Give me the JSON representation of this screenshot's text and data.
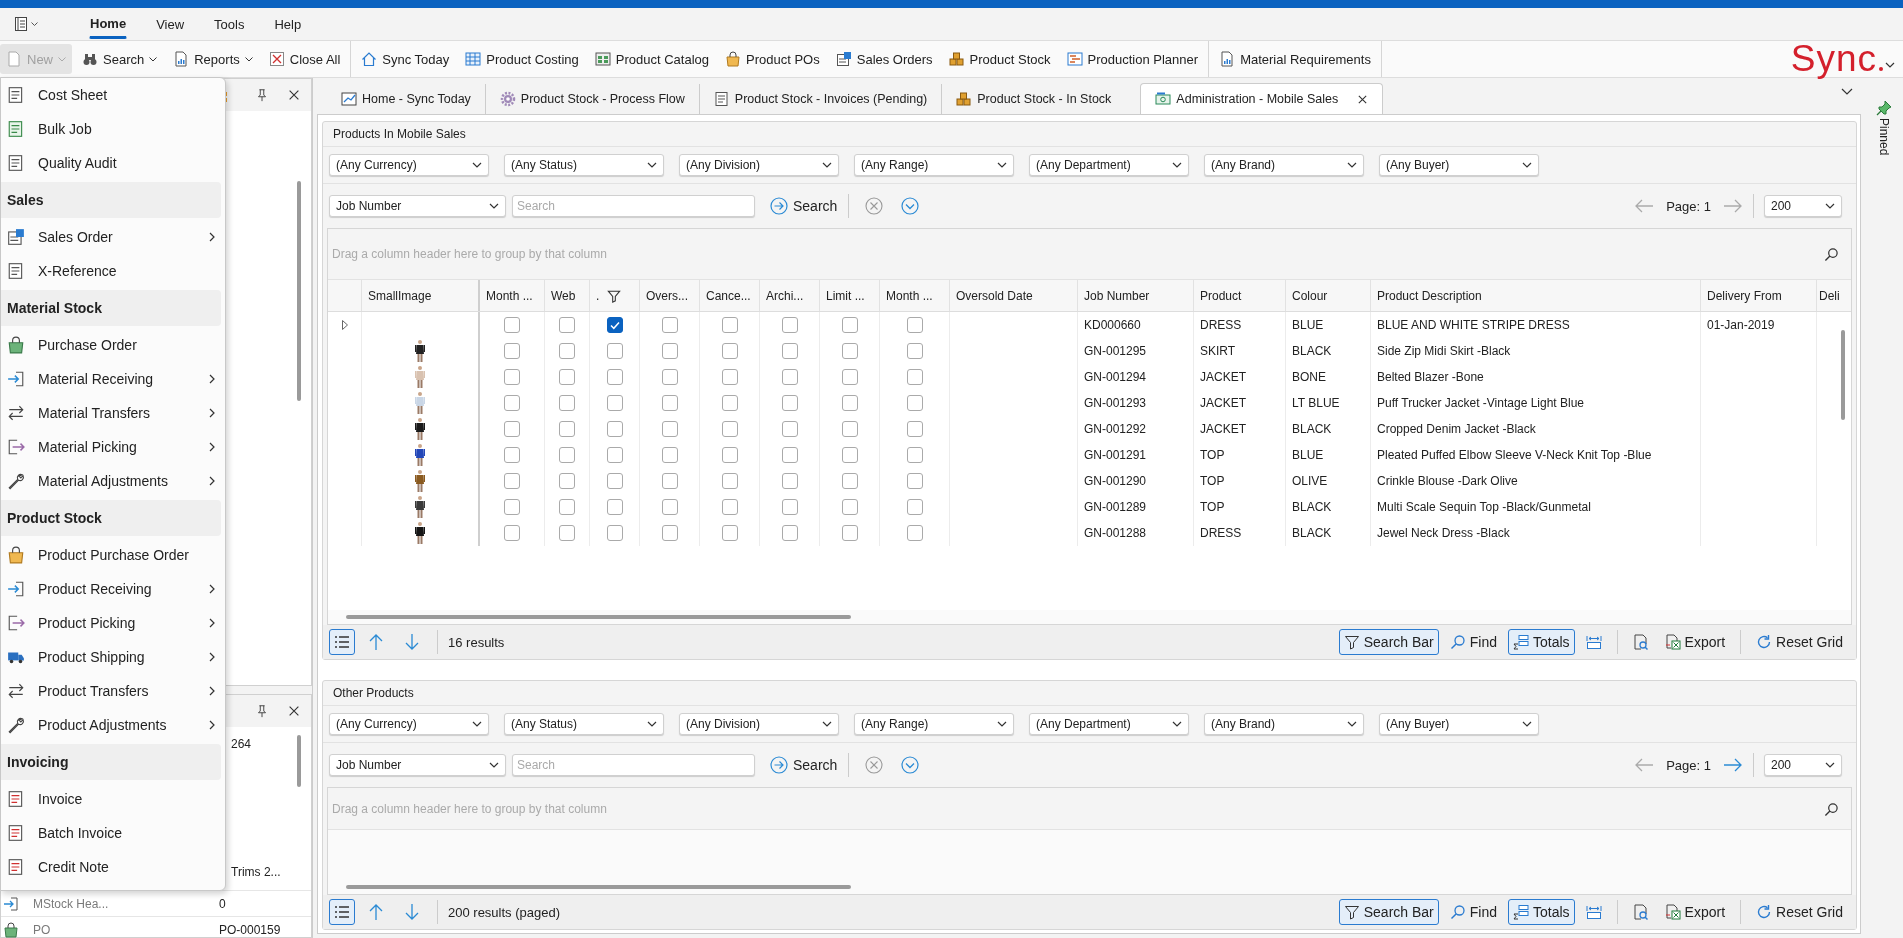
{
  "menu_tabs": [
    {
      "label": "Home",
      "selected": true
    },
    {
      "label": "View",
      "selected": false
    },
    {
      "label": "Tools",
      "selected": false
    },
    {
      "label": "Help",
      "selected": false
    }
  ],
  "toolbar": [
    [
      {
        "label": "New",
        "kind": "dropdown",
        "disabled": true,
        "open": true
      },
      {
        "label": "Search",
        "kind": "dropdown",
        "disabled": false,
        "open": false
      },
      {
        "label": "Reports",
        "kind": "dropdown",
        "disabled": false,
        "open": false
      },
      {
        "label": "Close All",
        "kind": "button",
        "disabled": false,
        "open": false
      }
    ],
    [
      {
        "label": "Sync Today",
        "kind": "button",
        "disabled": false,
        "open": false
      },
      {
        "label": "Product Costing",
        "kind": "button",
        "disabled": false,
        "open": false
      },
      {
        "label": "Product Catalog",
        "kind": "button",
        "disabled": false,
        "open": false
      },
      {
        "label": "Product POs",
        "kind": "button",
        "disabled": false,
        "open": false
      },
      {
        "label": "Sales Orders",
        "kind": "button",
        "disabled": false,
        "open": false
      },
      {
        "label": "Product Stock",
        "kind": "button",
        "disabled": false,
        "open": false
      },
      {
        "label": "Production Planner",
        "kind": "button",
        "disabled": false,
        "open": false
      }
    ],
    [
      {
        "label": "Material Requirements",
        "kind": "button",
        "disabled": false,
        "open": false
      }
    ]
  ],
  "logo": "Sync",
  "doc_tabs": [
    {
      "label": "Home - Sync Today",
      "selected": false
    },
    {
      "label": "Product Stock - Process Flow",
      "selected": false
    },
    {
      "label": "Product Stock - Invoices (Pending)",
      "selected": false
    },
    {
      "label": "Product Stock - In Stock",
      "selected": false
    },
    {
      "label": "Administration - Mobile Sales",
      "selected": true
    }
  ],
  "pinned_label": "Pinned",
  "new_menu": [
    {
      "kind": "item",
      "label": "Cost Sheet",
      "submenu": false
    },
    {
      "kind": "item",
      "label": "Bulk Job",
      "submenu": false
    },
    {
      "kind": "item",
      "label": "Quality Audit",
      "submenu": false
    },
    {
      "kind": "header",
      "label": "Sales"
    },
    {
      "kind": "item",
      "label": "Sales Order",
      "submenu": true
    },
    {
      "kind": "item",
      "label": "X-Reference",
      "submenu": false
    },
    {
      "kind": "header",
      "label": "Material Stock"
    },
    {
      "kind": "item",
      "label": "Purchase Order",
      "submenu": false
    },
    {
      "kind": "item",
      "label": "Material Receiving",
      "submenu": true
    },
    {
      "kind": "item",
      "label": "Material Transfers",
      "submenu": true
    },
    {
      "kind": "item",
      "label": "Material Picking",
      "submenu": true
    },
    {
      "kind": "item",
      "label": "Material Adjustments",
      "submenu": true
    },
    {
      "kind": "header",
      "label": "Product Stock"
    },
    {
      "kind": "item",
      "label": "Product Purchase Order",
      "submenu": false
    },
    {
      "kind": "item",
      "label": "Product Receiving",
      "submenu": true
    },
    {
      "kind": "item",
      "label": "Product Picking",
      "submenu": true
    },
    {
      "kind": "item",
      "label": "Product Shipping",
      "submenu": true
    },
    {
      "kind": "item",
      "label": "Product Transfers",
      "submenu": true
    },
    {
      "kind": "item",
      "label": "Product Adjustments",
      "submenu": true
    },
    {
      "kind": "header",
      "label": "Invoicing"
    },
    {
      "kind": "item",
      "label": "Invoice",
      "submenu": false
    },
    {
      "kind": "item",
      "label": "Batch Invoice",
      "submenu": false
    },
    {
      "kind": "item",
      "label": "Credit Note",
      "submenu": false
    }
  ],
  "side_panel": {
    "fragments": [
      "264",
      "Trims 2..."
    ],
    "rows": [
      {
        "label": "MStock Hea...",
        "value": "0"
      },
      {
        "label": "PO",
        "value": "PO-000159"
      }
    ]
  },
  "sections": [
    {
      "title": "Products In Mobile Sales",
      "filters": [
        "(Any Currency)",
        "(Any Status)",
        "(Any Division)",
        "(Any Range)",
        "(Any Department)",
        "(Any Brand)",
        "(Any Buyer)"
      ],
      "search": {
        "field": "Job Number",
        "placeholder": "Search",
        "button": "Search"
      },
      "pager": {
        "label": "Page: 1",
        "prev_enabled": false,
        "next_enabled": false,
        "page_size": "200"
      },
      "group_hint": "Drag a column header here to group by that column",
      "grid": {
        "columns": [
          {
            "label": "SmallImage",
            "filtered": false
          },
          {
            "label": "Month ...",
            "kind": "check",
            "filtered": false
          },
          {
            "label": "Web",
            "kind": "check",
            "filtered": false
          },
          {
            "label": ".",
            "kind": "check",
            "filtered": true
          },
          {
            "label": "Overs...",
            "kind": "check",
            "filtered": false
          },
          {
            "label": "Cance...",
            "kind": "check",
            "filtered": false
          },
          {
            "label": "Archi...",
            "kind": "check",
            "filtered": false
          },
          {
            "label": "Limit ...",
            "kind": "check",
            "filtered": false
          },
          {
            "label": "Month ...",
            "kind": "check",
            "filtered": false
          },
          {
            "label": "Oversold Date",
            "kind": "text",
            "filtered": false
          },
          {
            "label": "Job Number",
            "kind": "text",
            "filtered": false
          },
          {
            "label": "Product",
            "kind": "text",
            "filtered": false
          },
          {
            "label": "Colour",
            "kind": "text",
            "filtered": false
          },
          {
            "label": "Product Description",
            "kind": "text",
            "filtered": false
          },
          {
            "label": "Delivery From",
            "kind": "text",
            "filtered": false
          },
          {
            "label": "Deli",
            "kind": "text",
            "filtered": false
          }
        ],
        "rows": [
          {
            "current": true,
            "cells": [
              false,
              false,
              false,
              true,
              false,
              false,
              false,
              false,
              false,
              null,
              "KD000660",
              "DRESS",
              "BLUE",
              "BLUE AND WHITE STRIPE DRESS",
              "01-Jan-2019",
              null
            ]
          },
          {
            "current": false,
            "cells": [
              true,
              false,
              false,
              false,
              false,
              false,
              false,
              false,
              false,
              null,
              "GN-001295",
              "SKIRT",
              "BLACK",
              "Side Zip Midi Skirt -Black",
              null,
              null
            ]
          },
          {
            "current": false,
            "cells": [
              true,
              false,
              false,
              false,
              false,
              false,
              false,
              false,
              false,
              null,
              "GN-001294",
              "JACKET",
              "BONE",
              "Belted Blazer -Bone",
              null,
              null
            ]
          },
          {
            "current": false,
            "cells": [
              true,
              false,
              false,
              false,
              false,
              false,
              false,
              false,
              false,
              null,
              "GN-001293",
              "JACKET",
              "LT BLUE",
              "Puff Trucker Jacket -Vintage Light Blue",
              null,
              null
            ]
          },
          {
            "current": false,
            "cells": [
              true,
              false,
              false,
              false,
              false,
              false,
              false,
              false,
              false,
              null,
              "GN-001292",
              "JACKET",
              "BLACK",
              "Cropped Denim Jacket -Black",
              null,
              null
            ]
          },
          {
            "current": false,
            "cells": [
              true,
              false,
              false,
              false,
              false,
              false,
              false,
              false,
              false,
              null,
              "GN-001291",
              "TOP",
              "BLUE",
              "Pleated Puffed Elbow Sleeve V-Neck Knit Top -Blue",
              null,
              null
            ]
          },
          {
            "current": false,
            "cells": [
              true,
              false,
              false,
              false,
              false,
              false,
              false,
              false,
              false,
              null,
              "GN-001290",
              "TOP",
              "OLIVE",
              "Crinkle Blouse -Dark Olive",
              null,
              null
            ]
          },
          {
            "current": false,
            "cells": [
              true,
              false,
              false,
              false,
              false,
              false,
              false,
              false,
              false,
              null,
              "GN-001289",
              "TOP",
              "BLACK",
              "Multi Scale Sequin Top -Black/Gunmetal",
              null,
              null
            ]
          },
          {
            "current": false,
            "cells": [
              true,
              false,
              false,
              false,
              false,
              false,
              false,
              false,
              false,
              null,
              "GN-001288",
              "DRESS",
              "BLACK",
              "Jewel Neck Dress -Black",
              null,
              null
            ]
          }
        ]
      },
      "footer": {
        "results": "16 results",
        "tools": [
          {
            "kind": "search_bar",
            "label": "Search Bar",
            "pressed": true
          },
          {
            "kind": "find",
            "label": "Find",
            "pressed": false
          },
          {
            "kind": "totals",
            "label": "Totals",
            "pressed": true
          },
          {
            "kind": "fit",
            "pressed": false
          },
          {
            "kind": "preview",
            "pressed": false
          },
          {
            "kind": "export",
            "label": "Export",
            "pressed": false
          },
          {
            "kind": "reset",
            "label": "Reset Grid",
            "pressed": false
          }
        ]
      }
    },
    {
      "title": "Other Products",
      "filters": [
        "(Any Currency)",
        "(Any Status)",
        "(Any Division)",
        "(Any Range)",
        "(Any Department)",
        "(Any Brand)",
        "(Any Buyer)"
      ],
      "search": {
        "field": "Job Number",
        "placeholder": "Search",
        "button": "Search"
      },
      "pager": {
        "label": "Page: 1",
        "prev_enabled": false,
        "next_enabled": true,
        "page_size": "200"
      },
      "group_hint": "Drag a column header here to group by that column",
      "footer": {
        "results": "200 results (paged)",
        "tools": [
          {
            "kind": "search_bar",
            "label": "Search Bar",
            "pressed": true
          },
          {
            "kind": "find",
            "label": "Find",
            "pressed": false
          },
          {
            "kind": "totals",
            "label": "Totals",
            "pressed": true
          },
          {
            "kind": "fit",
            "pressed": false
          },
          {
            "kind": "preview",
            "pressed": false
          },
          {
            "kind": "export",
            "label": "Export",
            "pressed": false
          },
          {
            "kind": "reset",
            "label": "Reset Grid",
            "pressed": false
          }
        ]
      }
    }
  ]
}
